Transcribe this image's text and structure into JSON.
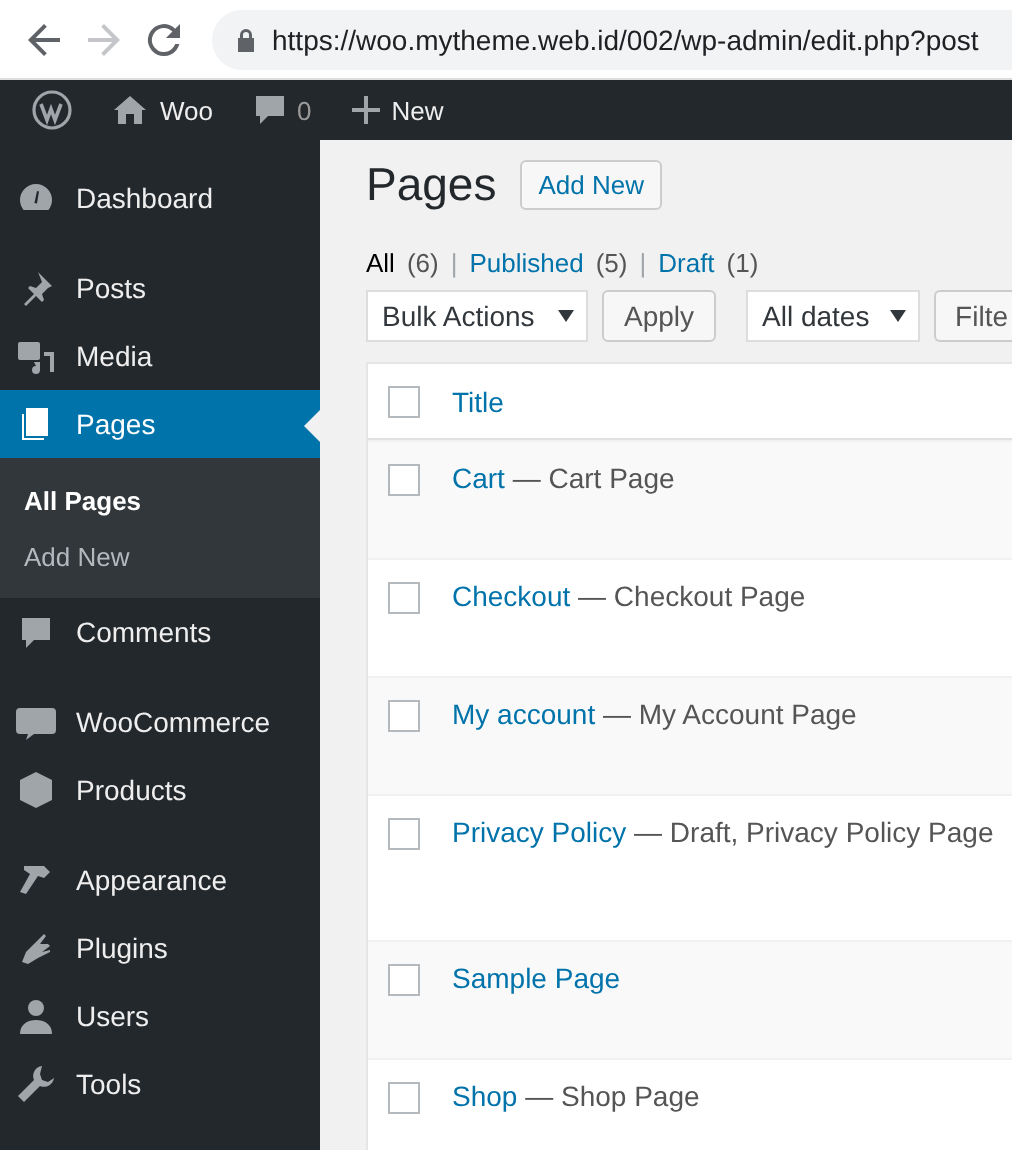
{
  "browser": {
    "url": "https://woo.mytheme.web.id/002/wp-admin/edit.php?post",
    "forward_disabled": true
  },
  "admin_bar": {
    "site": "Woo",
    "comments": "0",
    "new": "New"
  },
  "sidebar": {
    "groups": [
      [
        {
          "label": "Dashboard",
          "selected": false
        }
      ],
      [
        {
          "label": "Posts",
          "selected": false
        },
        {
          "label": "Media",
          "selected": false
        },
        {
          "label": "Pages",
          "selected": true,
          "children": [
            {
              "label": "All Pages",
              "selected": true
            },
            {
              "label": "Add New",
              "selected": false
            }
          ]
        },
        {
          "label": "Comments",
          "selected": false
        }
      ],
      [
        {
          "label": "WooCommerce",
          "selected": false
        },
        {
          "label": "Products",
          "selected": false
        }
      ],
      [
        {
          "label": "Appearance",
          "selected": false
        },
        {
          "label": "Plugins",
          "selected": false
        },
        {
          "label": "Users",
          "selected": false
        },
        {
          "label": "Tools",
          "selected": false
        }
      ]
    ]
  },
  "page": {
    "title": "Pages",
    "add_new": "Add New",
    "filters": [
      {
        "label": "All",
        "count": "(6)",
        "selected": true
      },
      {
        "separator": "|",
        "label": "Published",
        "count": "(5)",
        "selected": false
      },
      {
        "separator": "|",
        "label": "Draft",
        "count": "(1)",
        "selected": false
      }
    ],
    "bulk_actions": "Bulk Actions",
    "apply": "Apply",
    "dates": "All dates",
    "filter": "Filte"
  },
  "table": {
    "columns": [
      {
        "label": "Title",
        "checked": false
      }
    ],
    "rows": [
      {
        "title": "Cart",
        "states": "— Cart Page",
        "checked": false
      },
      {
        "title": "Checkout",
        "states": "— Checkout Page",
        "checked": false
      },
      {
        "title": "My account",
        "states": "— My Account Page",
        "checked": false
      },
      {
        "title": "Privacy Policy",
        "states": "— Draft, Privacy Policy Page",
        "checked": false
      },
      {
        "title": "Sample Page",
        "checked": false
      },
      {
        "title": "Shop",
        "states": "— Shop Page",
        "checked": false
      }
    ]
  }
}
